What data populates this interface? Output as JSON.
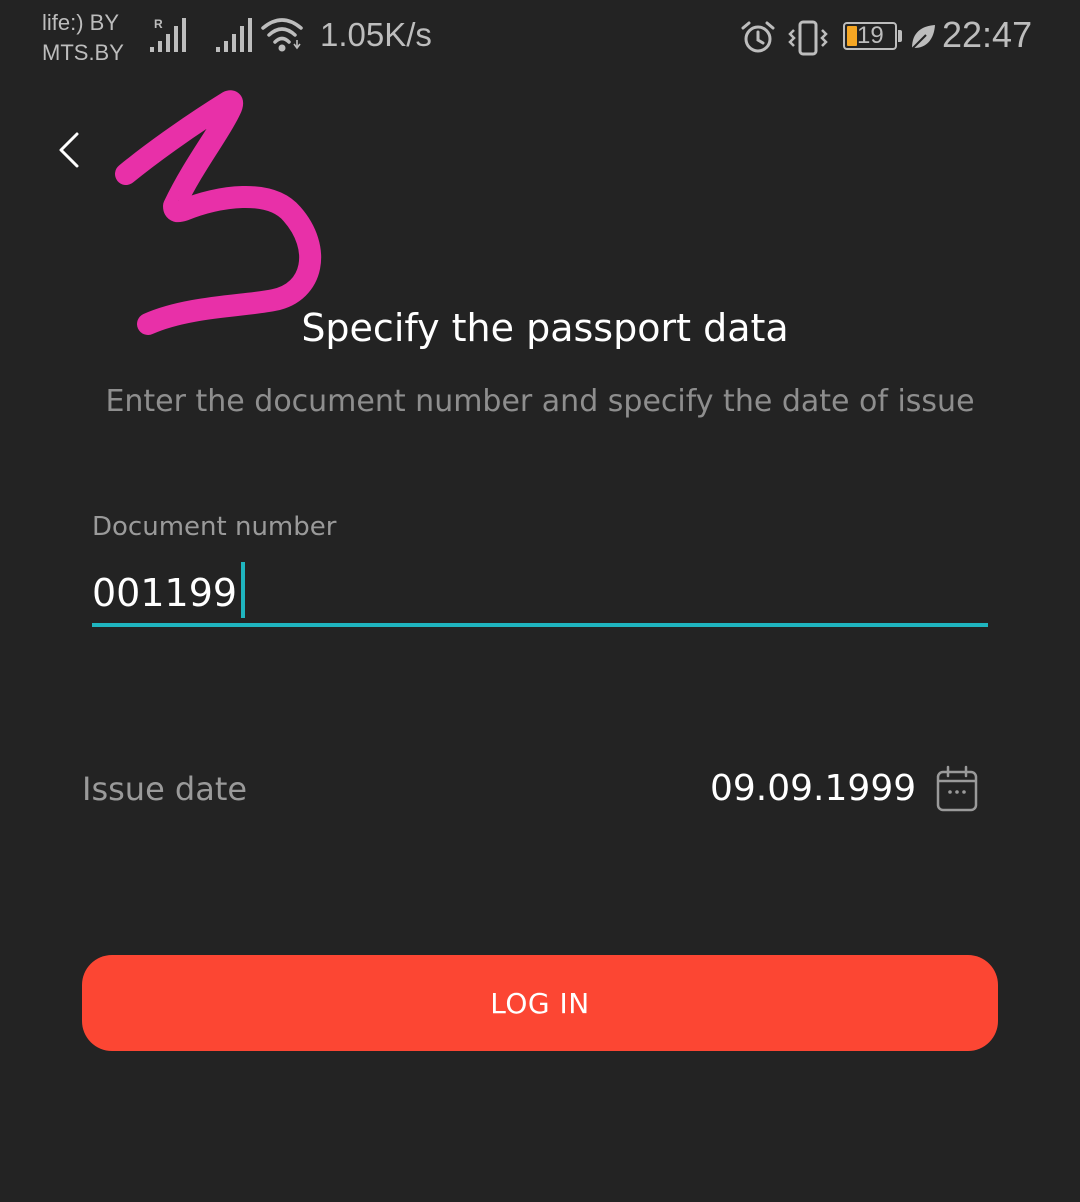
{
  "status_bar": {
    "carrier_1": "life:) BY",
    "carrier_2": "MTS.BY",
    "roaming_label": "R",
    "net_speed": "1.05K/s",
    "battery_level": "19",
    "time": "22:47",
    "icons": [
      "signal-roaming-icon",
      "signal-icon",
      "wifi-icon",
      "alarm-icon",
      "vibrate-icon",
      "battery-icon",
      "leaf-icon"
    ]
  },
  "annotation": {
    "handwritten_mark": "3"
  },
  "page": {
    "title": "Specify the passport data",
    "subtitle": "Enter the document number and specify the date of issue"
  },
  "document_field": {
    "label": "Document number",
    "value": "001199"
  },
  "issue_date": {
    "label": "Issue date",
    "value": "09.09.1999"
  },
  "login_button": {
    "label": "LOG IN"
  },
  "colors": {
    "background": "#232323",
    "accent_underline": "#1fb5bf",
    "button": "#fc4633",
    "annotation": "#e830a8",
    "battery_fill": "#f5a623"
  }
}
